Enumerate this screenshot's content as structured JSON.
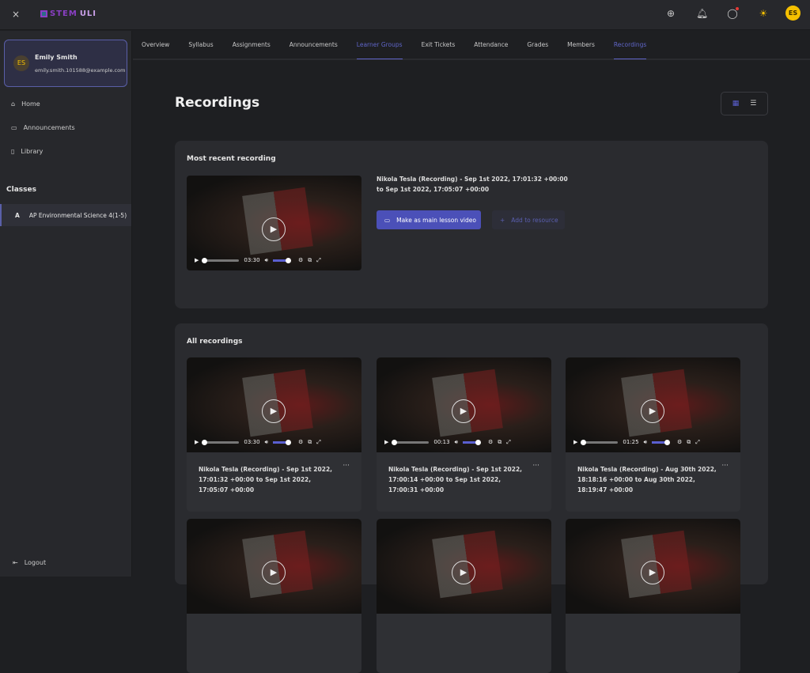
{
  "app": {
    "close": "×",
    "logo": [
      "STEM",
      "ULI"
    ]
  },
  "topbar": {
    "icons": [
      "add-circle-icon",
      "bell-icon",
      "chat-icon",
      "sun-icon"
    ],
    "avatar": "ES",
    "accent": "#f5c000"
  },
  "user": {
    "initials": "ES",
    "name": "Emily Smith",
    "email": "emily.smith.101588@example.com"
  },
  "nav": [
    {
      "label": "Home",
      "icon": "⌂"
    },
    {
      "label": "Announcements",
      "icon": "▭"
    },
    {
      "label": "Library",
      "icon": "▯"
    }
  ],
  "classes": {
    "heading": "Classes",
    "items": [
      {
        "letter": "A",
        "label": "AP Environmental Science 4(1-5)"
      }
    ]
  },
  "logout": "Logout",
  "tabs": [
    "Overview",
    "Syllabus",
    "Assignments",
    "Announcements",
    "Learner Groups",
    "Exit Tickets",
    "Attendance",
    "Grades",
    "Members",
    "Recordings"
  ],
  "page": {
    "title": "Recordings"
  },
  "recent": {
    "heading": "Most recent recording",
    "title": "Nikola Tesla (Recording) - Sep 1st 2022, 17:01:32 +00:00 to Sep 1st 2022, 17:05:07 +00:00",
    "duration": "03:30",
    "main_button": "Make as main lesson video",
    "add_button": "Add to resource"
  },
  "all": {
    "heading": "All recordings",
    "items": [
      {
        "title": "Nikola Tesla (Recording) - Sep 1st 2022, 17:01:32 +00:00 to Sep 1st 2022, 17:05:07 +00:00",
        "duration": "03:30"
      },
      {
        "title": "Nikola Tesla (Recording) - Sep 1st 2022, 17:00:14 +00:00 to Sep 1st 2022, 17:00:31 +00:00",
        "duration": "00:13"
      },
      {
        "title": "Nikola Tesla (Recording) - Aug 30th 2022, 18:18:16 +00:00 to Aug 30th 2022, 18:19:47 +00:00",
        "duration": "01:25"
      }
    ],
    "more": "···"
  }
}
